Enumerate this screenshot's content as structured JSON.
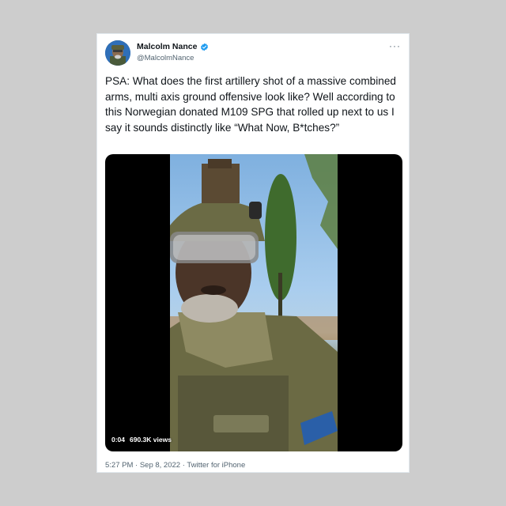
{
  "tweet": {
    "author_name": "Malcolm Nance",
    "handle": "@MalcolmNance",
    "more_label": "···",
    "text": "PSA: What does the first artillery shot of a massive combined arms, multi axis ground offensive look like? Well according to this Norwegian donated M109 SPG that rolled up next to us I say it sounds distinctly like “What Now, B*tches?”",
    "video": {
      "timestamp": "0:04",
      "views": "690.3K views"
    },
    "footer": "5:27 PM · Sep 8, 2022 · Twitter for iPhone"
  },
  "colors": {
    "background": "#cdcdcd",
    "verified": "#1d9bf0",
    "secondary_text": "#536471"
  },
  "icons": {
    "verified": "verified-badge-icon",
    "more": "more-horizontal-icon"
  }
}
